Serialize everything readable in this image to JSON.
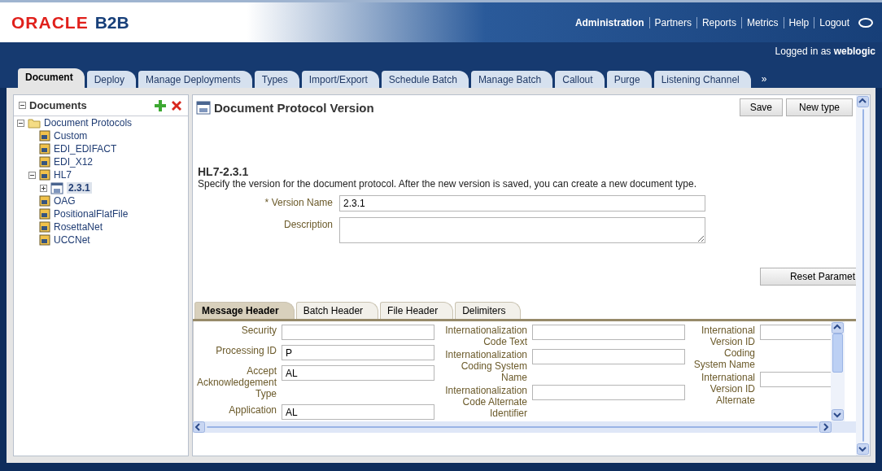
{
  "header": {
    "logo": {
      "brand": "ORACLE",
      "product": "B2B"
    },
    "nav": [
      {
        "label": "Administration",
        "selected": true
      },
      {
        "label": "Partners",
        "selected": false
      },
      {
        "label": "Reports",
        "selected": false
      },
      {
        "label": "Metrics",
        "selected": false
      },
      {
        "label": "Help",
        "selected": false
      },
      {
        "label": "Logout",
        "selected": false
      }
    ],
    "login": "Logged in as **weblogic**"
  },
  "tabs": [
    {
      "label": "Document",
      "selected": true
    },
    {
      "label": "Deploy",
      "selected": false
    },
    {
      "label": "Manage Deployments",
      "selected": false
    },
    {
      "label": "Types",
      "selected": false
    },
    {
      "label": "Import/Export",
      "selected": false
    },
    {
      "label": "Schedule Batch",
      "selected": false
    },
    {
      "label": "Manage Batch",
      "selected": false
    },
    {
      "label": "Callout",
      "selected": false
    },
    {
      "label": "Purge",
      "selected": false
    },
    {
      "label": "Listening Channel",
      "selected": false
    }
  ],
  "more_tabs": "»",
  "sidebar": {
    "title": "Documents",
    "expanded": true,
    "tree": [
      {
        "label": "Document Protocols",
        "kind": "folder",
        "expanded": true,
        "selected": false,
        "children": [
          {
            "label": "Custom",
            "kind": "protocol",
            "selected": false
          },
          {
            "label": "EDI_EDIFACT",
            "kind": "protocol",
            "selected": false
          },
          {
            "label": "EDI_X12",
            "kind": "protocol",
            "selected": false
          },
          {
            "label": "HL7",
            "kind": "protocol",
            "expanded": true,
            "selected": false,
            "children": [
              {
                "label": "2.3.1",
                "kind": "version",
                "expanded": false,
                "selected": true
              }
            ]
          },
          {
            "label": "OAG",
            "kind": "protocol",
            "selected": false
          },
          {
            "label": "PositionalFlatFile",
            "kind": "protocol",
            "selected": false
          },
          {
            "label": "RosettaNet",
            "kind": "protocol",
            "selected": false
          },
          {
            "label": "UCCNet",
            "kind": "protocol",
            "selected": false
          }
        ]
      }
    ]
  },
  "panel": {
    "title": "Document Protocol Version",
    "buttons": [
      "Save",
      "New type"
    ],
    "heading": "HL7-2.3.1",
    "instructions": "Specify the version for the document protocol. After the new version is saved, you can create a new document type.",
    "fields": [
      {
        "marker": "*",
        "label": "Version Name",
        "value": "2.3.1",
        "kind": "line"
      },
      {
        "label": "Description",
        "kind": "area"
      }
    ],
    "reset_button": "Reset Paramet",
    "sub_tabs": [
      {
        "label": "Message Header",
        "selected": true
      },
      {
        "label": "Batch Header",
        "selected": false
      },
      {
        "label": "File Header",
        "selected": false
      },
      {
        "label": "Delimiters",
        "selected": false
      }
    ],
    "columns": [
      [
        {
          "label": "Security"
        },
        {
          "label": "Processing ID",
          "value": "P"
        },
        {
          "label": "Accept Acknowledgement Type",
          "value": "AL"
        },
        {
          "label": "Application",
          "value": "AL"
        }
      ],
      [
        {
          "label": "Internationalization Code Text"
        },
        {
          "label": "Internationalization Coding System Name"
        },
        {
          "label": "Internationalization Code Alternate Identifier"
        }
      ],
      [
        {
          "label": "International Version ID Coding System Name"
        },
        {
          "label": "International Version ID Alternate"
        }
      ]
    ]
  }
}
